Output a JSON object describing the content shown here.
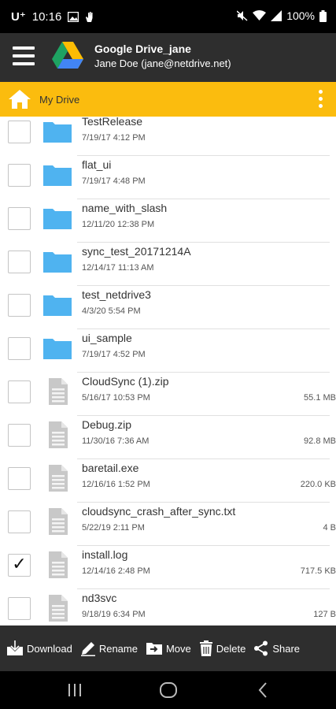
{
  "status_bar": {
    "carrier": "U⁺",
    "time": "10:16",
    "battery": "100%"
  },
  "app_bar": {
    "title": "Google Drive_jane",
    "subtitle": "Jane Doe (jane@netdrive.net)"
  },
  "path_bar": {
    "label": "My Drive"
  },
  "files": [
    {
      "name": "TestRelease",
      "date": "7/19/17 4:12 PM",
      "size": "",
      "type": "folder",
      "checked": false
    },
    {
      "name": "flat_ui",
      "date": "7/19/17 4:48 PM",
      "size": "",
      "type": "folder",
      "checked": false
    },
    {
      "name": "name_with_slash",
      "date": "12/11/20 12:38 PM",
      "size": "",
      "type": "folder",
      "checked": false
    },
    {
      "name": "sync_test_20171214A",
      "date": "12/14/17 11:13 AM",
      "size": "",
      "type": "folder",
      "checked": false
    },
    {
      "name": "test_netdrive3",
      "date": "4/3/20 5:54 PM",
      "size": "",
      "type": "folder",
      "checked": false
    },
    {
      "name": "ui_sample",
      "date": "7/19/17 4:52 PM",
      "size": "",
      "type": "folder",
      "checked": false
    },
    {
      "name": "CloudSync (1).zip",
      "date": "5/16/17 10:53 PM",
      "size": "55.1 MB",
      "type": "file",
      "checked": false
    },
    {
      "name": "Debug.zip",
      "date": "11/30/16 7:36 AM",
      "size": "92.8 MB",
      "type": "file",
      "checked": false
    },
    {
      "name": "baretail.exe",
      "date": "12/16/16 1:52 PM",
      "size": "220.0 KB",
      "type": "file",
      "checked": false
    },
    {
      "name": "cloudsync_crash_after_sync.txt",
      "date": "5/22/19 2:11 PM",
      "size": "4 B",
      "type": "file",
      "checked": false
    },
    {
      "name": "install.log",
      "date": "12/14/16 2:48 PM",
      "size": "717.5 KB",
      "type": "file",
      "checked": true
    },
    {
      "name": "nd3svc",
      "date": "9/18/19 6:34 PM",
      "size": "127 B",
      "type": "file",
      "checked": false
    }
  ],
  "checkmark": "✓",
  "actions": {
    "download": "Download",
    "rename": "Rename",
    "move": "Move",
    "delete": "Delete",
    "share": "Share"
  },
  "colors": {
    "app_bar": "#2e2e2e",
    "path_bar": "#fbbc0e",
    "folder": "#4fb3f0",
    "file_icon": "#c8c8c8"
  }
}
